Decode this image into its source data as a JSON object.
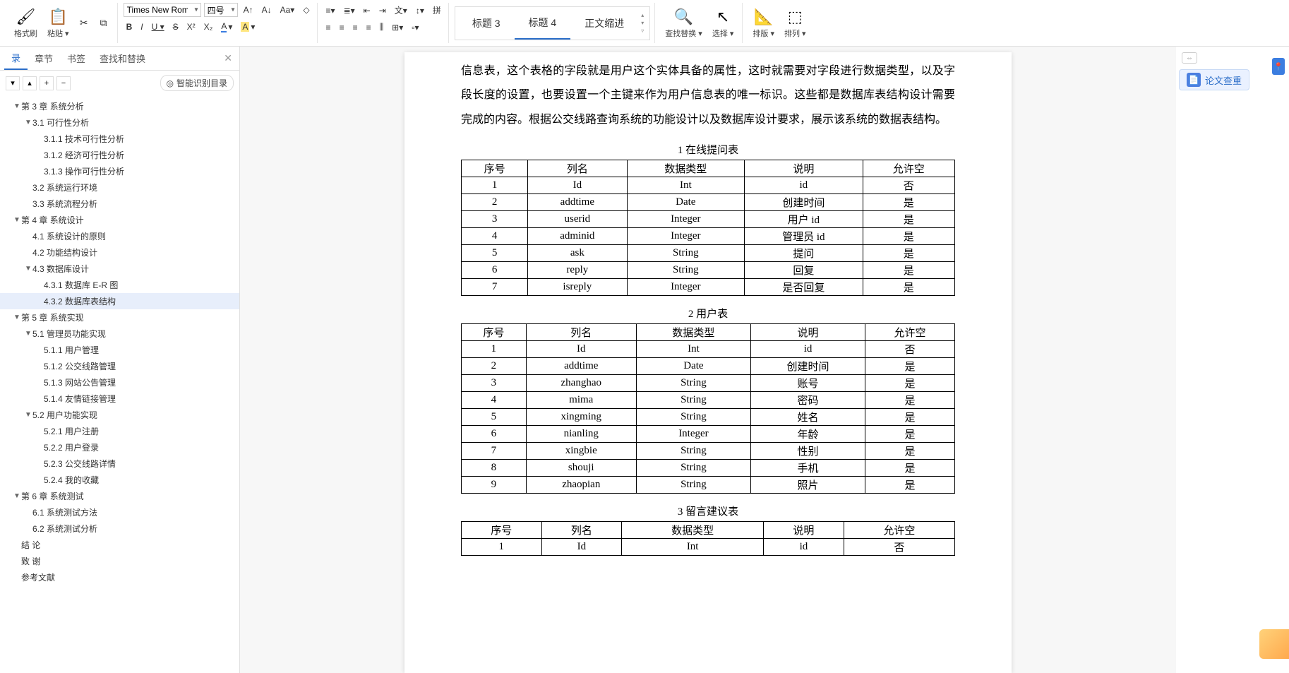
{
  "toolbar": {
    "format_painter": "格式刷",
    "paste": "粘贴",
    "font_name": "Times New Roma",
    "font_size": "四号",
    "styles": {
      "h3": "标题 3",
      "h4": "标题 4",
      "body_indent": "正文缩进"
    },
    "find_replace": "查找替换",
    "select": "选择",
    "layout": "排版",
    "arrange": "排列"
  },
  "sidebar": {
    "tabs": {
      "toc": "录",
      "chapter": "章节",
      "bookmark": "书签",
      "find": "查找和替换"
    },
    "smart": "智能识别目录",
    "items": [
      {
        "lvl": 1,
        "caret": "▼",
        "text": "第 3 章 系统分析"
      },
      {
        "lvl": 2,
        "caret": "▼",
        "text": "3.1 可行性分析"
      },
      {
        "lvl": 3,
        "caret": "",
        "text": "3.1.1 技术可行性分析"
      },
      {
        "lvl": 3,
        "caret": "",
        "text": "3.1.2 经济可行性分析"
      },
      {
        "lvl": 3,
        "caret": "",
        "text": "3.1.3 操作可行性分析"
      },
      {
        "lvl": 2,
        "caret": "",
        "text": "3.2 系统运行环境"
      },
      {
        "lvl": 2,
        "caret": "",
        "text": "3.3 系统流程分析"
      },
      {
        "lvl": 1,
        "caret": "▼",
        "text": "第 4 章 系统设计"
      },
      {
        "lvl": 2,
        "caret": "",
        "text": "4.1 系统设计的原则"
      },
      {
        "lvl": 2,
        "caret": "",
        "text": "4.2 功能结构设计"
      },
      {
        "lvl": 2,
        "caret": "▼",
        "text": "4.3 数据库设计"
      },
      {
        "lvl": 3,
        "caret": "",
        "text": "4.3.1 数据库 E-R 图"
      },
      {
        "lvl": 3,
        "caret": "",
        "text": "4.3.2 数据库表结构",
        "active": true
      },
      {
        "lvl": 1,
        "caret": "▼",
        "text": "第 5 章 系统实现"
      },
      {
        "lvl": 2,
        "caret": "▼",
        "text": "5.1 管理员功能实现"
      },
      {
        "lvl": 3,
        "caret": "",
        "text": "5.1.1 用户管理"
      },
      {
        "lvl": 3,
        "caret": "",
        "text": "5.1.2 公交线路管理"
      },
      {
        "lvl": 3,
        "caret": "",
        "text": "5.1.3 网站公告管理"
      },
      {
        "lvl": 3,
        "caret": "",
        "text": "5.1.4 友情链接管理"
      },
      {
        "lvl": 2,
        "caret": "▼",
        "text": "5.2 用户功能实现"
      },
      {
        "lvl": 3,
        "caret": "",
        "text": "5.2.1 用户注册"
      },
      {
        "lvl": 3,
        "caret": "",
        "text": "5.2.2 用户登录"
      },
      {
        "lvl": 3,
        "caret": "",
        "text": "5.2.3 公交线路详情"
      },
      {
        "lvl": 3,
        "caret": "",
        "text": "5.2.4 我的收藏"
      },
      {
        "lvl": 1,
        "caret": "▼",
        "text": "第 6 章 系统测试"
      },
      {
        "lvl": 2,
        "caret": "",
        "text": "6.1 系统测试方法"
      },
      {
        "lvl": 2,
        "caret": "",
        "text": "6.2 系统测试分析"
      },
      {
        "lvl": 1,
        "caret": "",
        "text": "结   论"
      },
      {
        "lvl": 1,
        "caret": "",
        "text": "致   谢"
      },
      {
        "lvl": 1,
        "caret": "",
        "text": "参考文献"
      }
    ]
  },
  "rightpanel": {
    "paper_check": "论文查重"
  },
  "document": {
    "paragraph": "信息表，这个表格的字段就是用户这个实体具备的属性，这时就需要对字段进行数据类型，以及字段长度的设置，也要设置一个主键来作为用户信息表的唯一标识。这些都是数据库表结构设计需要完成的内容。根据公交线路查询系统的功能设计以及数据库设计要求，展示该系统的数据表结构。",
    "headers": [
      "序号",
      "列名",
      "数据类型",
      "说明",
      "允许空"
    ],
    "tables": [
      {
        "caption": "1 在线提问表",
        "rows": [
          [
            "1",
            "Id",
            "Int",
            "id",
            "否"
          ],
          [
            "2",
            "addtime",
            "Date",
            "创建时间",
            "是"
          ],
          [
            "3",
            "userid",
            "Integer",
            "用户 id",
            "是"
          ],
          [
            "4",
            "adminid",
            "Integer",
            "管理员 id",
            "是"
          ],
          [
            "5",
            "ask",
            "String",
            "提问",
            "是"
          ],
          [
            "6",
            "reply",
            "String",
            "回复",
            "是"
          ],
          [
            "7",
            "isreply",
            "Integer",
            "是否回复",
            "是"
          ]
        ]
      },
      {
        "caption": "2 用户表",
        "rows": [
          [
            "1",
            "Id",
            "Int",
            "id",
            "否"
          ],
          [
            "2",
            "addtime",
            "Date",
            "创建时间",
            "是"
          ],
          [
            "3",
            "zhanghao",
            "String",
            "账号",
            "是"
          ],
          [
            "4",
            "mima",
            "String",
            "密码",
            "是"
          ],
          [
            "5",
            "xingming",
            "String",
            "姓名",
            "是"
          ],
          [
            "6",
            "nianling",
            "Integer",
            "年龄",
            "是"
          ],
          [
            "7",
            "xingbie",
            "String",
            "性别",
            "是"
          ],
          [
            "8",
            "shouji",
            "String",
            "手机",
            "是"
          ],
          [
            "9",
            "zhaopian",
            "String",
            "照片",
            "是"
          ]
        ]
      },
      {
        "caption": "3 留言建议表",
        "rows": [
          [
            "1",
            "Id",
            "Int",
            "id",
            "否"
          ]
        ]
      }
    ]
  }
}
